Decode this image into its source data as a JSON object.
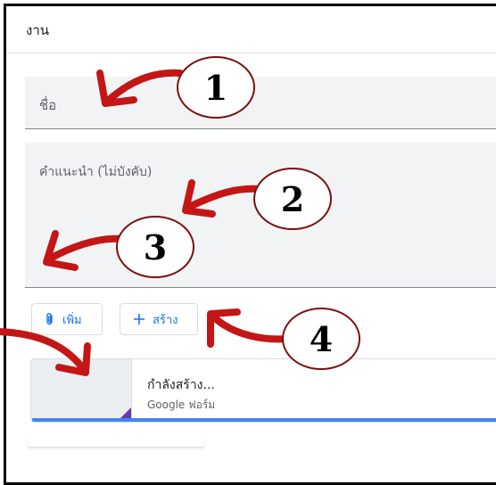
{
  "header": {
    "title": "งาน"
  },
  "name_field": {
    "label": "ชื่อ"
  },
  "description_field": {
    "label": "คำแนะนำ (ไม่บังคับ)"
  },
  "buttons": {
    "add_label": "เพิ่ม",
    "create_label": "สร้าง",
    "add_icon": "paperclip-icon",
    "create_icon": "plus-icon"
  },
  "attachment": {
    "title": "กำลังสร้าง...",
    "subtitle": "Google ฟอร์ม",
    "progress": 1.0
  },
  "callouts": [
    "1",
    "2",
    "3",
    "4"
  ],
  "colors": {
    "accent": "#1a73e8",
    "arrow": "#c41616",
    "forms_purple": "#673ab7",
    "progress": "#4285f4"
  }
}
